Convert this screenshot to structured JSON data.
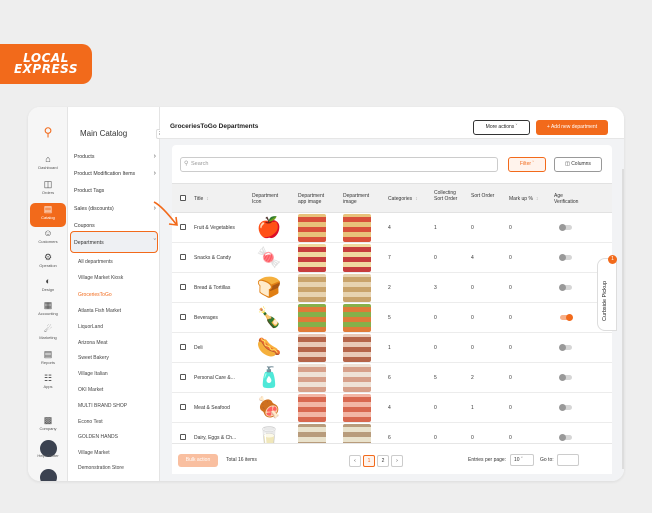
{
  "brand": {
    "logo_text": "LOCAL EXPRESS",
    "accent": "#f26a1b"
  },
  "rail": [
    {
      "label": "Dashboard",
      "icon": "home-icon"
    },
    {
      "label": "Orders",
      "icon": "orders-icon"
    },
    {
      "label": "Catalog",
      "icon": "catalog-icon",
      "active": true
    },
    {
      "label": "Customers",
      "icon": "customers-icon"
    },
    {
      "label": "Operation",
      "icon": "operation-icon"
    },
    {
      "label": "Design",
      "icon": "design-icon"
    },
    {
      "label": "Accounting",
      "icon": "accounting-icon"
    },
    {
      "label": "Marketing",
      "icon": "marketing-icon"
    },
    {
      "label": "Reports",
      "icon": "reports-icon"
    },
    {
      "label": "Apps",
      "icon": "apps-icon"
    },
    {
      "label": "Company",
      "icon": "company-icon"
    },
    {
      "label": "Help Center",
      "icon": "help-icon"
    }
  ],
  "sidebar": {
    "title": "Main Catalog",
    "items": [
      "Products",
      "Product Modification Items",
      "Product Tags",
      "Sales (discounts)",
      "Coupons",
      "Departments"
    ],
    "subitems": [
      "All departments",
      "Village Market Kiosk",
      "GroceriesToGo",
      "Atlanta Fish Market",
      "LiquorLand",
      "Arizona Meat",
      "Sweet Bakery",
      "Village Italian",
      "OKI Market",
      "MULTI BRAND SHOP",
      "Econo Test",
      "GOLDEN HANDS",
      "Village Market",
      "Demonstration Store"
    ]
  },
  "header": {
    "title": "GroceriesToGo Departments",
    "more_actions": "More actions",
    "add_new": "Add new department"
  },
  "toolbar": {
    "search_placeholder": "Search",
    "filter": "Filter",
    "columns": "Columns"
  },
  "table": {
    "headers": [
      "Title",
      "Department Icon",
      "Department app image",
      "Department image",
      "Categories",
      "Collecting Sort Order",
      "Sort Order",
      "Mark up %",
      "Age Verification"
    ],
    "rows": [
      {
        "title": "Fruit & Vegetables",
        "categories": "4",
        "collecting": "1",
        "sort": "0",
        "markup": "0",
        "age": false,
        "icon": "fruit-veg-icon"
      },
      {
        "title": "Snacks & Candy",
        "categories": "7",
        "collecting": "0",
        "sort": "4",
        "markup": "0",
        "age": false,
        "icon": "candy-icon"
      },
      {
        "title": "Bread & Tortillas",
        "categories": "2",
        "collecting": "3",
        "sort": "0",
        "markup": "0",
        "age": false,
        "icon": "bread-icon"
      },
      {
        "title": "Beverages",
        "categories": "5",
        "collecting": "0",
        "sort": "0",
        "markup": "0",
        "age": true,
        "icon": "bottles-icon"
      },
      {
        "title": "Deli",
        "categories": "1",
        "collecting": "0",
        "sort": "0",
        "markup": "0",
        "age": false,
        "icon": "sausage-icon"
      },
      {
        "title": "Personal Care &...",
        "categories": "6",
        "collecting": "5",
        "sort": "2",
        "markup": "0",
        "age": false,
        "icon": "personal-care-icon"
      },
      {
        "title": "Meat & Seafood",
        "categories": "4",
        "collecting": "0",
        "sort": "1",
        "markup": "0",
        "age": false,
        "icon": "meat-icon"
      },
      {
        "title": "Dairy, Eggs & Ch...",
        "categories": "6",
        "collecting": "0",
        "sort": "0",
        "markup": "0",
        "age": false,
        "icon": "dairy-icon"
      }
    ]
  },
  "footer": {
    "bulk": "Bulk action",
    "total": "Total 16 items",
    "pages": [
      "1",
      "2"
    ],
    "per_page_label": "Entries per page:",
    "per_page": "10",
    "goto": "Go to:"
  },
  "curbside": {
    "label": "Curbside Pickup",
    "badge": "1"
  }
}
